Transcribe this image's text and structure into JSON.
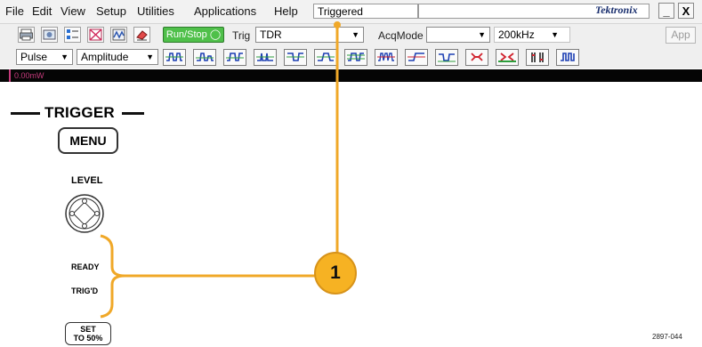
{
  "menu": {
    "items": [
      "File",
      "Edit",
      "View",
      "Setup",
      "Utilities",
      "Applications",
      "Help"
    ],
    "status": "Triggered",
    "brand": "Tektronix",
    "minimize": "_",
    "close": "X"
  },
  "toolbar": {
    "run_stop": "Run/Stop",
    "trig_label": "Trig",
    "trig_value": "TDR",
    "acqmode_label": "AcqMode",
    "acqmode_value": "",
    "freq_value": "200kHz",
    "app_label": "App",
    "trigger_type": "Pulse",
    "trigger_param": "Amplitude",
    "icons": [
      "print-icon",
      "screenshot-icon",
      "measure-icon",
      "mask-icon",
      "waveform-icon",
      "eraser-icon"
    ]
  },
  "strip": {
    "power_label": "0.00mW"
  },
  "panel": {
    "title": "TRIGGER",
    "menu_button": "MENU",
    "level_label": "LEVEL",
    "ready_label": "READY",
    "trigd_label": "TRIG'D",
    "set_button_line1": "SET",
    "set_button_line2": "TO 50%"
  },
  "callout": {
    "number": "1",
    "color": "#f6b223"
  },
  "figure_id": "2897-044",
  "colors": {
    "run_stop_green": "#4fc04a",
    "trigger_icon_blue": "#1d3fb3",
    "trigger_icon_green": "#2e9e3d",
    "trigger_icon_red": "#d0232e",
    "callout_line": "#f0a828"
  }
}
